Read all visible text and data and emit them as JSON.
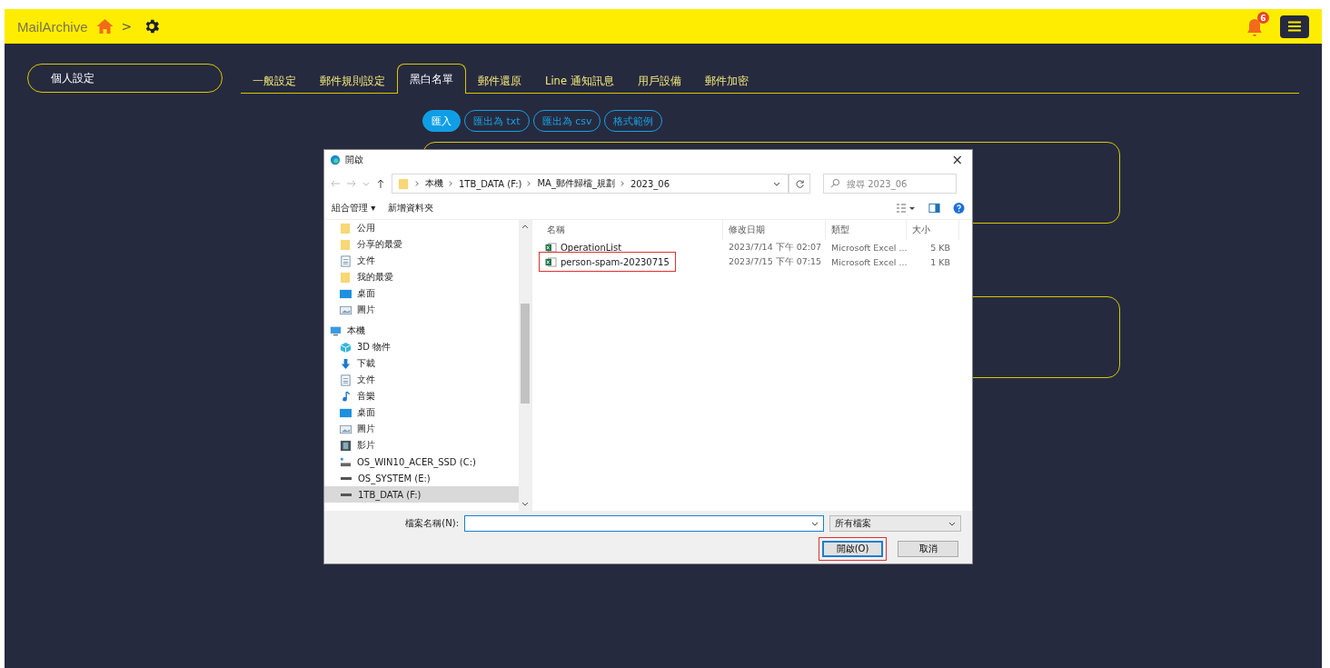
{
  "header": {
    "brand": "MailArchive",
    "breadcrumb_separator": ">",
    "notification_count": "6"
  },
  "sidebar": {
    "items": [
      {
        "label": "個人設定",
        "selected": true
      }
    ]
  },
  "tabs": [
    {
      "label": "一般設定",
      "selected": false
    },
    {
      "label": "郵件規則設定",
      "selected": false
    },
    {
      "label": "黑白名單",
      "selected": true
    },
    {
      "label": "郵件還原",
      "selected": false
    },
    {
      "label": "Line 通知訊息",
      "selected": false
    },
    {
      "label": "用戶設備",
      "selected": false
    },
    {
      "label": "郵件加密",
      "selected": false
    }
  ],
  "actions": [
    {
      "label": "匯入",
      "selected": true
    },
    {
      "label": "匯出為 txt",
      "selected": false
    },
    {
      "label": "匯出為 csv",
      "selected": false
    },
    {
      "label": "格式範例",
      "selected": false
    }
  ],
  "panels": [
    {
      "kind": "list"
    },
    {
      "kind": "list"
    }
  ],
  "dialog": {
    "title": "開啟",
    "close": "×",
    "path": [
      "本機",
      "1TB_DATA (F:)",
      "MA_郵件歸檔_規劃",
      "2023_06"
    ],
    "search": {
      "placeholder": "搜尋 2023_06"
    },
    "toolbar": [
      "組合管理 ▾",
      "新增資料夾"
    ],
    "nav": [
      {
        "label": "公用",
        "kind": "folder",
        "selected": false
      },
      {
        "label": "分享的最愛",
        "kind": "folder",
        "selected": false
      },
      {
        "label": "文件",
        "kind": "doc",
        "selected": false
      },
      {
        "label": "我的最愛",
        "kind": "folder",
        "selected": false
      },
      {
        "label": "桌面",
        "kind": "desktop",
        "selected": false
      },
      {
        "label": "圖片",
        "kind": "pictures",
        "selected": false
      },
      {
        "label": "本機",
        "kind": "pc",
        "selected": false,
        "children": [
          {
            "label": "3D 物件",
            "kind": "cube",
            "selected": false
          },
          {
            "label": "下載",
            "kind": "download",
            "selected": false
          },
          {
            "label": "文件",
            "kind": "doc",
            "selected": false
          },
          {
            "label": "音樂",
            "kind": "music",
            "selected": false
          },
          {
            "label": "桌面",
            "kind": "desktop",
            "selected": false
          },
          {
            "label": "圖片",
            "kind": "pictures",
            "selected": false
          },
          {
            "label": "影片",
            "kind": "video",
            "selected": false
          },
          {
            "label": "OS_WIN10_ACER_SSD (C:)",
            "kind": "sysdrive",
            "selected": false
          },
          {
            "label": "OS_SYSTEM (E:)",
            "kind": "drive",
            "selected": false
          },
          {
            "label": "1TB_DATA (F:)",
            "kind": "drive",
            "selected": true
          }
        ]
      }
    ],
    "columns": [
      "名稱",
      "修改日期",
      "類型",
      "大小"
    ],
    "files": [
      {
        "name": "OperationList",
        "modified": "2023/7/14 下午 02:07",
        "type": "Microsoft Excel ...",
        "size": "5 KB",
        "highlighted": false
      },
      {
        "name": "person-spam-20230715",
        "modified": "2023/7/15 下午 07:15",
        "type": "Microsoft Excel ...",
        "size": "1 KB",
        "highlighted": true
      }
    ],
    "filename_label": "檔案名稱(N):",
    "filter": "所有檔案",
    "buttons": [
      {
        "label": "開啟(O)",
        "kind": "primary",
        "highlighted": true
      },
      {
        "label": "取消",
        "kind": "secondary",
        "highlighted": false
      }
    ]
  }
}
